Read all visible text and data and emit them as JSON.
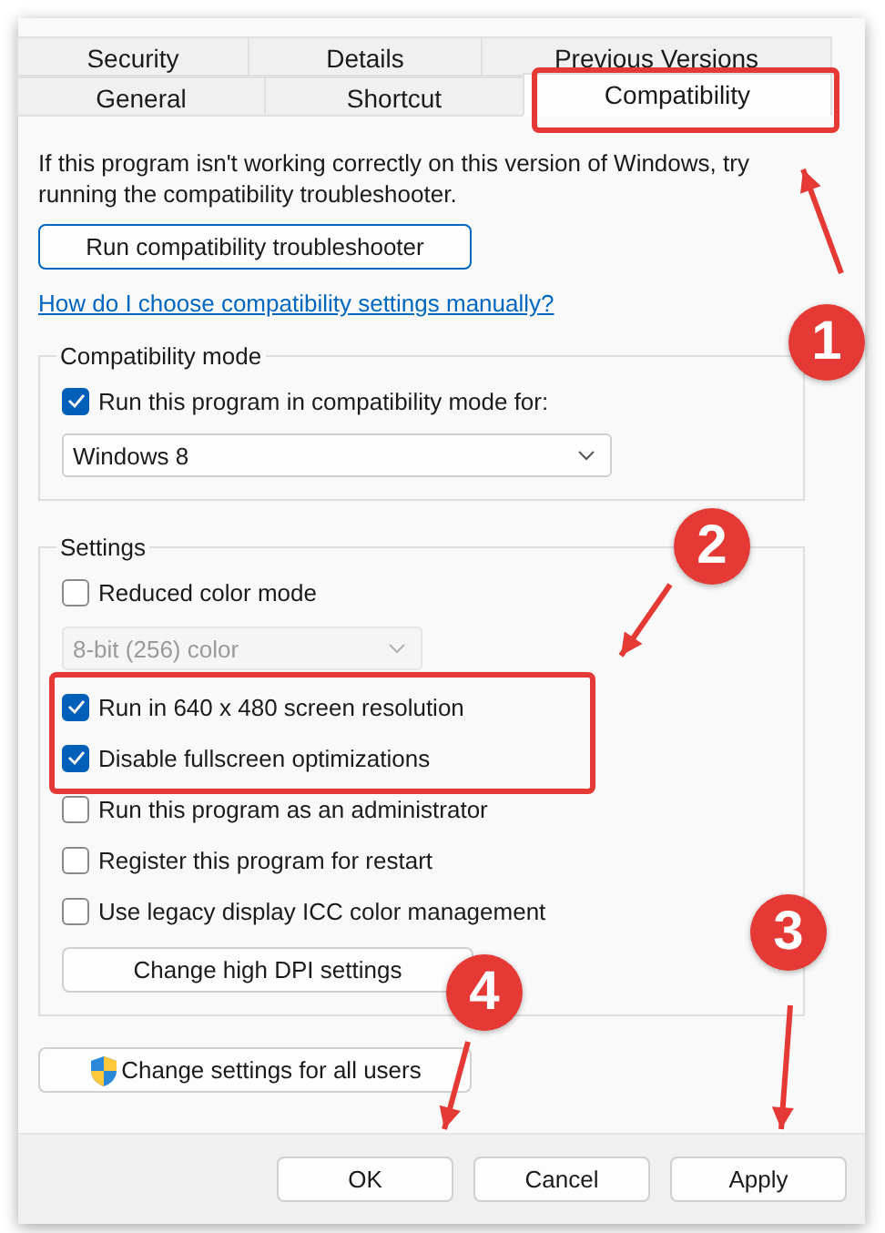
{
  "tabs": [
    [
      {
        "label": "Security",
        "selected": false
      },
      {
        "label": "Details",
        "selected": false
      },
      {
        "label": "Previous Versions",
        "selected": false
      }
    ],
    [
      {
        "label": "General",
        "selected": false
      },
      {
        "label": "Shortcut",
        "selected": false
      },
      {
        "label": "Compatibility",
        "selected": true
      }
    ]
  ],
  "description": "If this program isn't working correctly on this version of Windows, try running the compatibility troubleshooter.",
  "troubleshooter_button": "Run compatibility troubleshooter",
  "help_link": "How do I choose compatibility settings manually?",
  "compatibility_mode": {
    "title": "Compatibility mode",
    "checkbox": {
      "label": "Run this program in compatibility mode for:",
      "checked": true
    },
    "select": {
      "value": "Windows 8",
      "disabled": false
    }
  },
  "settings": {
    "title": "Settings",
    "items": [
      {
        "kind": "checkbox",
        "label": "Reduced color mode",
        "checked": false
      },
      {
        "kind": "select",
        "value": "8-bit (256) color",
        "disabled": true
      },
      {
        "kind": "checkbox",
        "label": "Run in 640 x 480 screen resolution",
        "checked": true
      },
      {
        "kind": "checkbox",
        "label": "Disable fullscreen optimizations",
        "checked": true
      },
      {
        "kind": "checkbox",
        "label": "Run this program as an administrator",
        "checked": false
      },
      {
        "kind": "checkbox",
        "label": "Register this program for restart",
        "checked": false
      },
      {
        "kind": "checkbox",
        "label": "Use legacy display ICC color management",
        "checked": false
      },
      {
        "kind": "button",
        "label": "Change high DPI settings"
      }
    ]
  },
  "all_users_button": "Change settings for all users",
  "buttons": [
    "OK",
    "Cancel",
    "Apply"
  ],
  "callouts": [
    {
      "number": "1",
      "highlight": true
    },
    {
      "number": "2",
      "highlight": true
    },
    {
      "number": "3",
      "highlight": false
    },
    {
      "number": "4",
      "highlight": false
    }
  ]
}
